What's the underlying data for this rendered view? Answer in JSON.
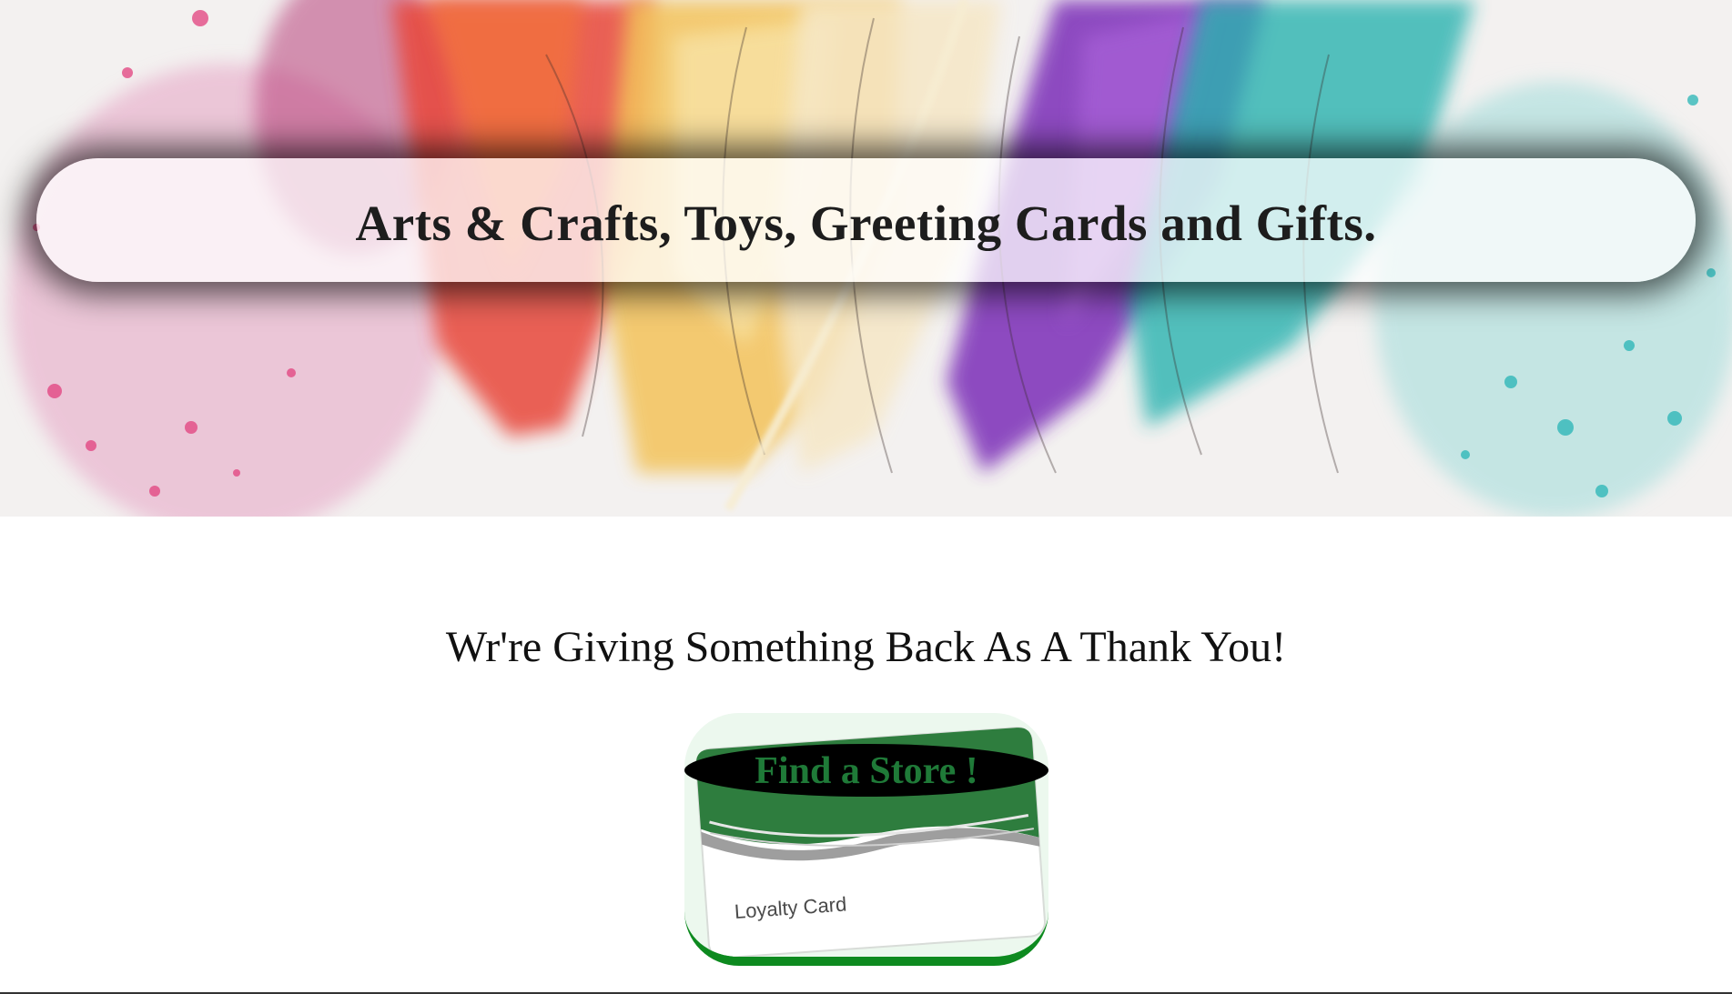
{
  "hero": {
    "tagline": "Arts & Crafts, Toys, Greeting Cards and Gifts."
  },
  "main": {
    "thank_you_heading": "Wr're Giving Something Back As A Thank You!",
    "find_store_button": "Find a Store !",
    "loyalty_card_label": "Loyalty Card"
  },
  "colors": {
    "find_store_text": "#1f7a38",
    "card_border": "#0d8a1f",
    "card_stripe": "#2e7d3e"
  },
  "icons": {
    "hero_image": "watercolor-feathers-image",
    "loyalty_card_image": "loyalty-card-image"
  }
}
